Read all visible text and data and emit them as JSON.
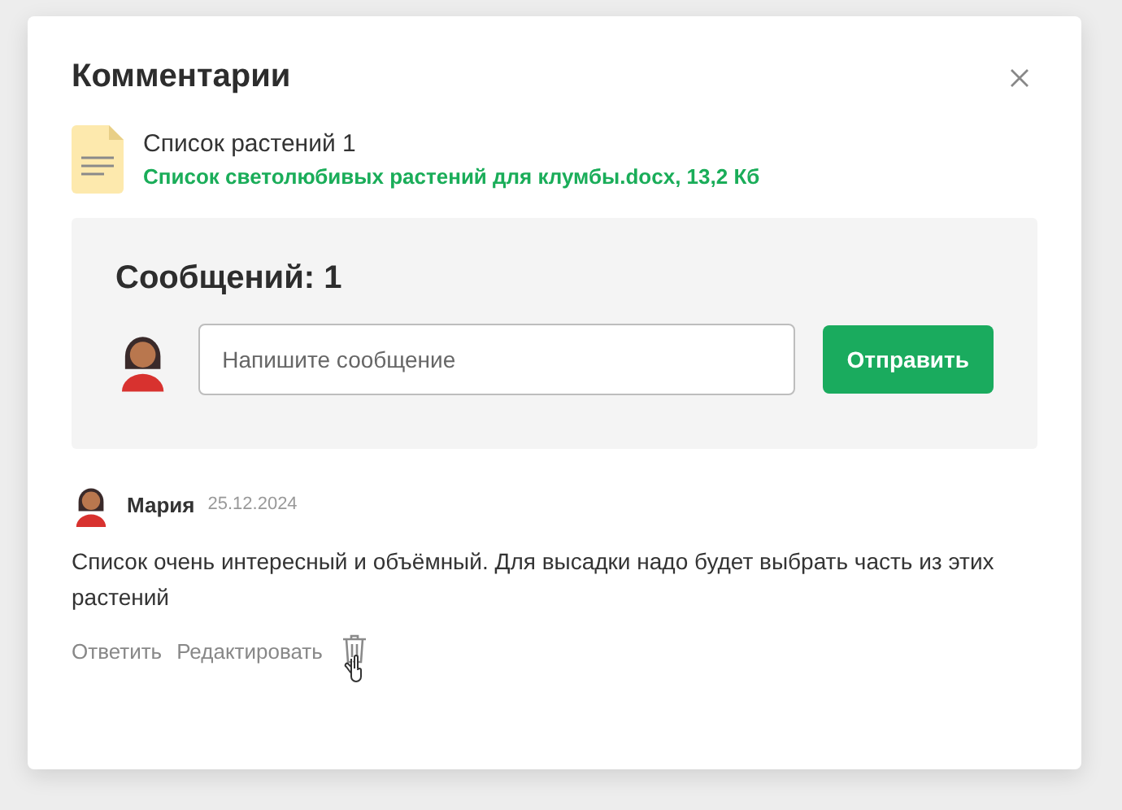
{
  "dialog": {
    "title": "Комментарии",
    "file": {
      "name": "Список растений 1",
      "link": "Список светолюбивых растений для клумбы.docx, 13,2 Кб"
    },
    "composer": {
      "heading": "Сообщений: 1",
      "placeholder": "Напишите сообщение",
      "send_button": "Отправить"
    },
    "comments": [
      {
        "author": "Мария",
        "date": "25.12.2024",
        "text": "Список очень интересный и объёмный. Для высадки надо будет выбрать часть из этих растений",
        "actions": [
          "Ответить",
          "Редактировать"
        ]
      }
    ]
  }
}
